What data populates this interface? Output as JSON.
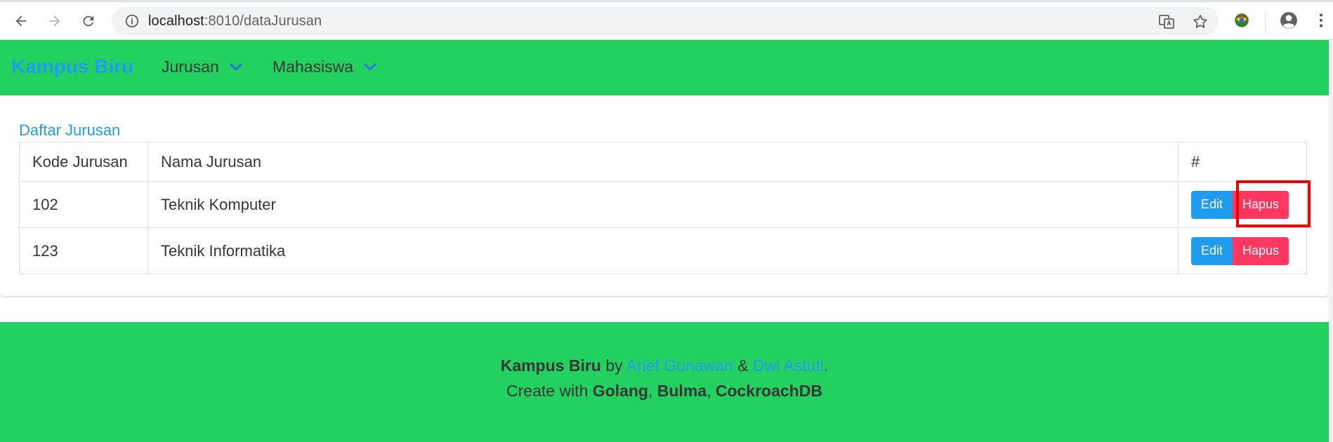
{
  "browser": {
    "url_host": "localhost",
    "url_path": ":8010/dataJurusan"
  },
  "navbar": {
    "brand": "Kampus Biru",
    "items": [
      {
        "label": "Jurusan"
      },
      {
        "label": "Mahasiswa"
      }
    ]
  },
  "main": {
    "title": "Daftar Jurusan",
    "table": {
      "headers": [
        "Kode Jurusan",
        "Nama Jurusan",
        "#"
      ],
      "rows": [
        {
          "kode": "102",
          "nama": "Teknik Komputer"
        },
        {
          "kode": "123",
          "nama": "Teknik Informatika"
        }
      ],
      "edit_label": "Edit",
      "delete_label": "Hapus"
    }
  },
  "footer": {
    "brand": "Kampus Biru",
    "by": "by",
    "author1": "Arief Gunawan",
    "amp": "&",
    "author2": "Dwi Astuti",
    "period": ".",
    "create_with": "Create with",
    "tech1": "Golang",
    "tech2": "Bulma",
    "tech3": "CockroachDB",
    "comma": ","
  },
  "colors": {
    "navbar_bg": "#23d160",
    "brand": "#209cee",
    "edit_button": "#209cee",
    "delete_button": "#ff3860",
    "highlight": "#ee0000"
  }
}
